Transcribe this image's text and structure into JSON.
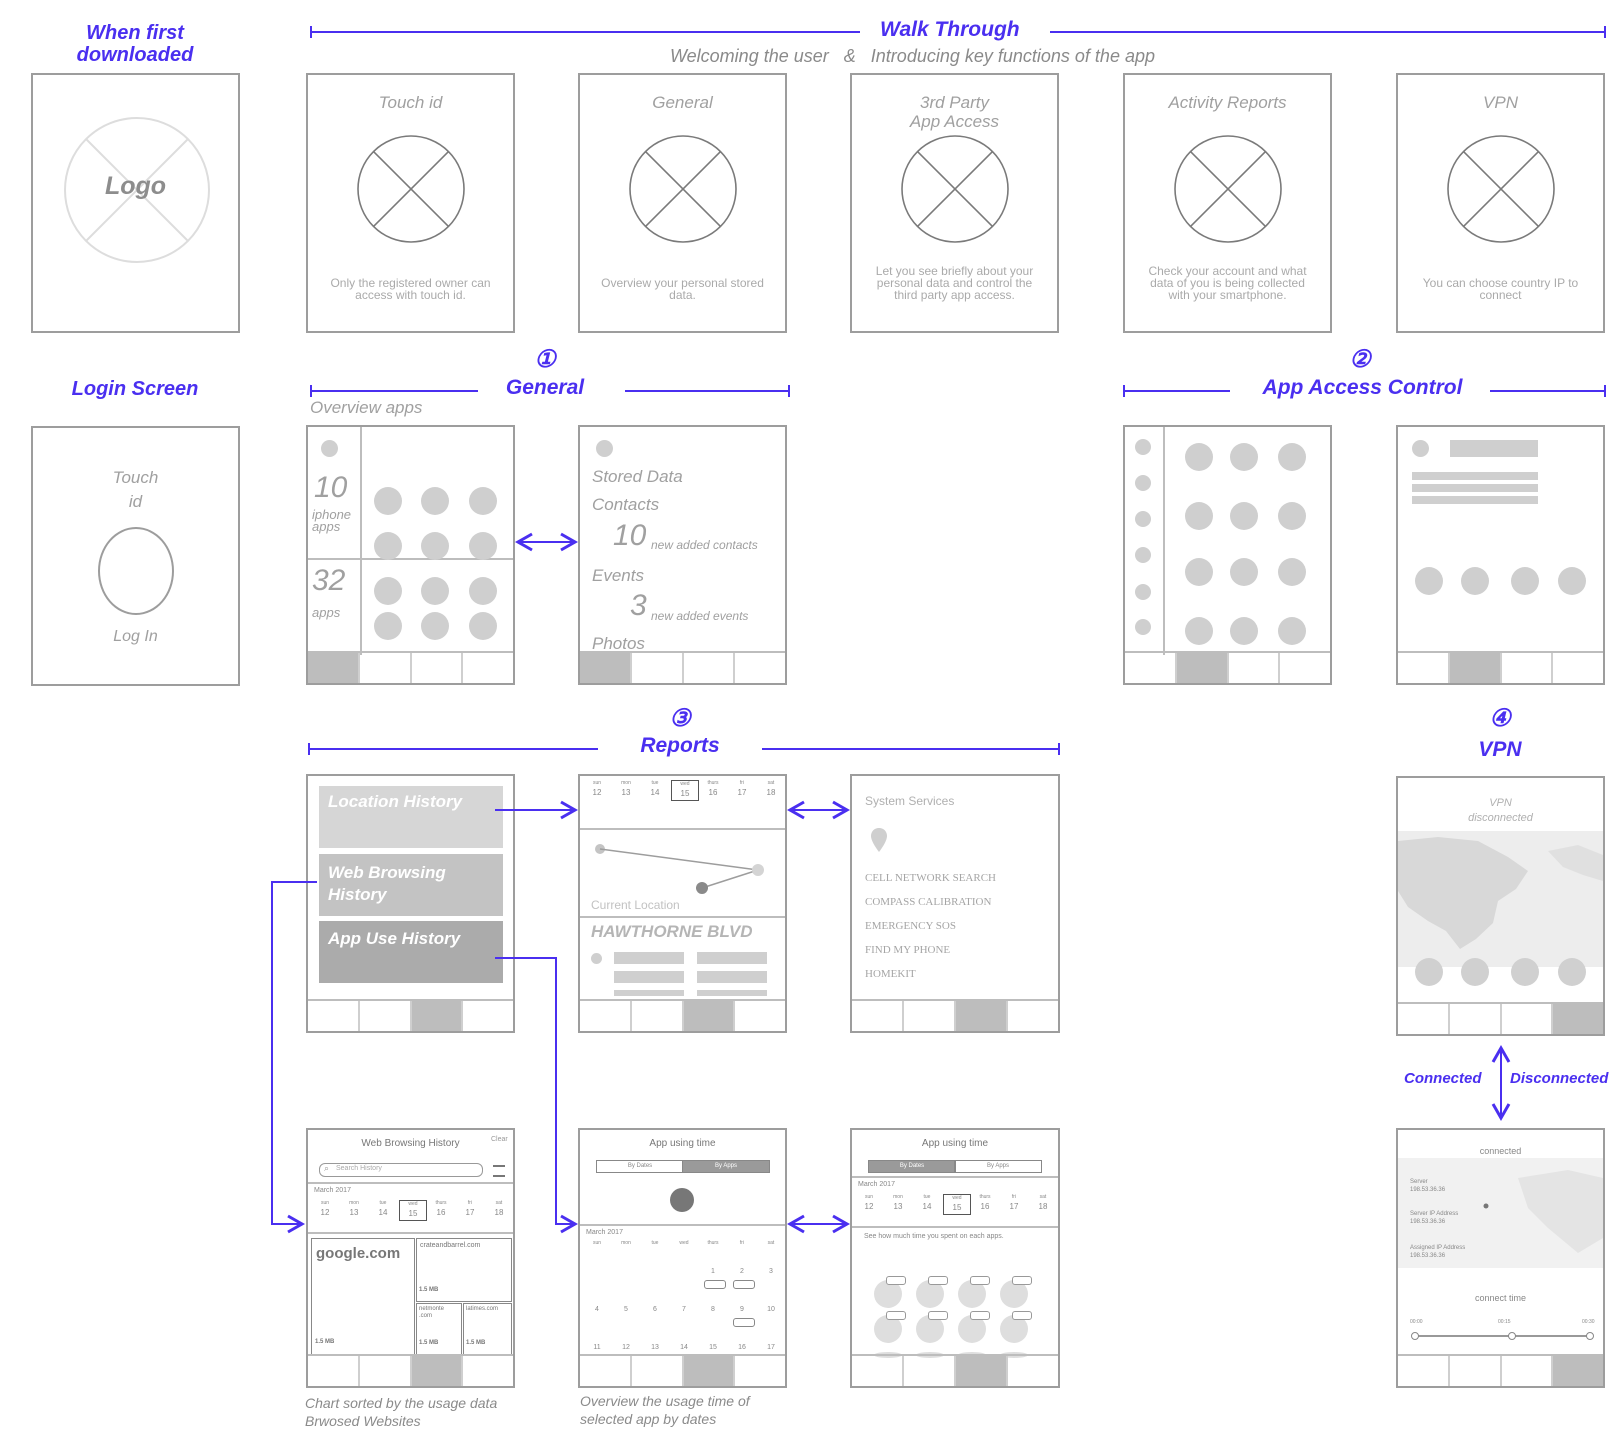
{
  "headings": {
    "first_download": "When first\ndownloaded",
    "walk_through": "Walk Through",
    "walk_sub_a": "Welcoming the user",
    "walk_sub_amp": "&",
    "walk_sub_b": "Introducing key functions of the app",
    "login": "Login Screen",
    "general_num": "①",
    "general": "General",
    "overview_apps": "Overview apps",
    "app_access_num": "②",
    "app_access": "App Access Control",
    "reports_num": "③",
    "reports": "Reports",
    "vpn_num": "④",
    "vpn": "VPN"
  },
  "logo_screen": {
    "logo": "Logo"
  },
  "walk_screens": [
    {
      "title": "Touch id",
      "desc": "Only the registered owner can access with touch id."
    },
    {
      "title": "General",
      "desc": "Overview your personal stored data."
    },
    {
      "title": "3rd Party\nApp Access",
      "desc": "Let you see briefly about your personal data and control the third party app access."
    },
    {
      "title": "Activity Reports",
      "desc": "Check your account and what data of you is being collected with your smartphone."
    },
    {
      "title": "VPN",
      "desc": "You can choose country IP to connect"
    }
  ],
  "login_screen": {
    "title": "Touch\nid",
    "button": "Log In"
  },
  "overview_screen": {
    "count_iphone": "10",
    "label_iphone": "iphone\napps",
    "count_apps": "32",
    "label_apps": "apps"
  },
  "stored_screen": {
    "title": "Stored Data",
    "contacts": "Contacts",
    "contacts_n": "10",
    "contacts_note": "new added contacts",
    "events": "Events",
    "events_n": "3",
    "events_note": "new added events",
    "photos": "Photos"
  },
  "reports_menu": [
    "Location History",
    "Web Browsing\nHistory",
    "App Use History"
  ],
  "week": {
    "days": [
      "sun",
      "mon",
      "tue",
      "wed",
      "thurs",
      "fri",
      "sat"
    ],
    "dates": [
      "12",
      "13",
      "14",
      "15",
      "16",
      "17",
      "18"
    ]
  },
  "location_screen": {
    "current": "Current Location",
    "street": "HAWTHORNE BLVD"
  },
  "services_screen": {
    "title": "System Services",
    "items": [
      "CELL NETWORK SEARCH",
      "COMPASS CALIBRATION",
      "EMERGENCY SOS",
      "FIND MY PHONE",
      "HOMEKIT"
    ]
  },
  "web_screen": {
    "title": "Web Browsing History",
    "clear": "Clear",
    "search_placeholder": "Search History",
    "month": "March 2017",
    "site_main": "google.com",
    "size_main": "1.5 MB",
    "site_2": "crateandbarrel.com",
    "size_2": "1.5 MB",
    "site_3": "netmonte\n.com",
    "size_3": "1.5 MB",
    "site_4": "latimes.com",
    "size_4": "1.5 MB"
  },
  "usage_screen": {
    "title": "App using time",
    "tab_a": "By Dates",
    "tab_b": "By Apps",
    "month": "March 2017",
    "row1": [
      "",
      "",
      "",
      "",
      "1",
      "2",
      "3"
    ],
    "row2": [
      "4",
      "5",
      "6",
      "7",
      "8",
      "9",
      "10"
    ],
    "row3": [
      "11",
      "12",
      "13",
      "14",
      "15",
      "16",
      "17"
    ]
  },
  "usage_screen2": {
    "title": "App using time",
    "tab_a": "By Dates",
    "tab_b": "By Apps",
    "month": "March 2017",
    "note": "See how much time you spent on each apps."
  },
  "vpn_screen1": {
    "title": "VPN\ndisconnected"
  },
  "vpn_toggle": {
    "left": "Connected",
    "right": "Disconnected"
  },
  "vpn_screen2": {
    "title": "connected",
    "server": "Server\n198.53.36.36",
    "server_ip": "Server IP Address\n198.53.36.36",
    "assigned_ip": "Assigned IP Address\n198.53.36.36",
    "connect_time": "connect time",
    "t1": "00:00",
    "t2": "00:15",
    "t3": "00:30"
  },
  "captions": {
    "web": "Chart sorted by the usage data\nBrwosed Websites",
    "usage": "Overview the usage time of\nselected app by dates"
  }
}
